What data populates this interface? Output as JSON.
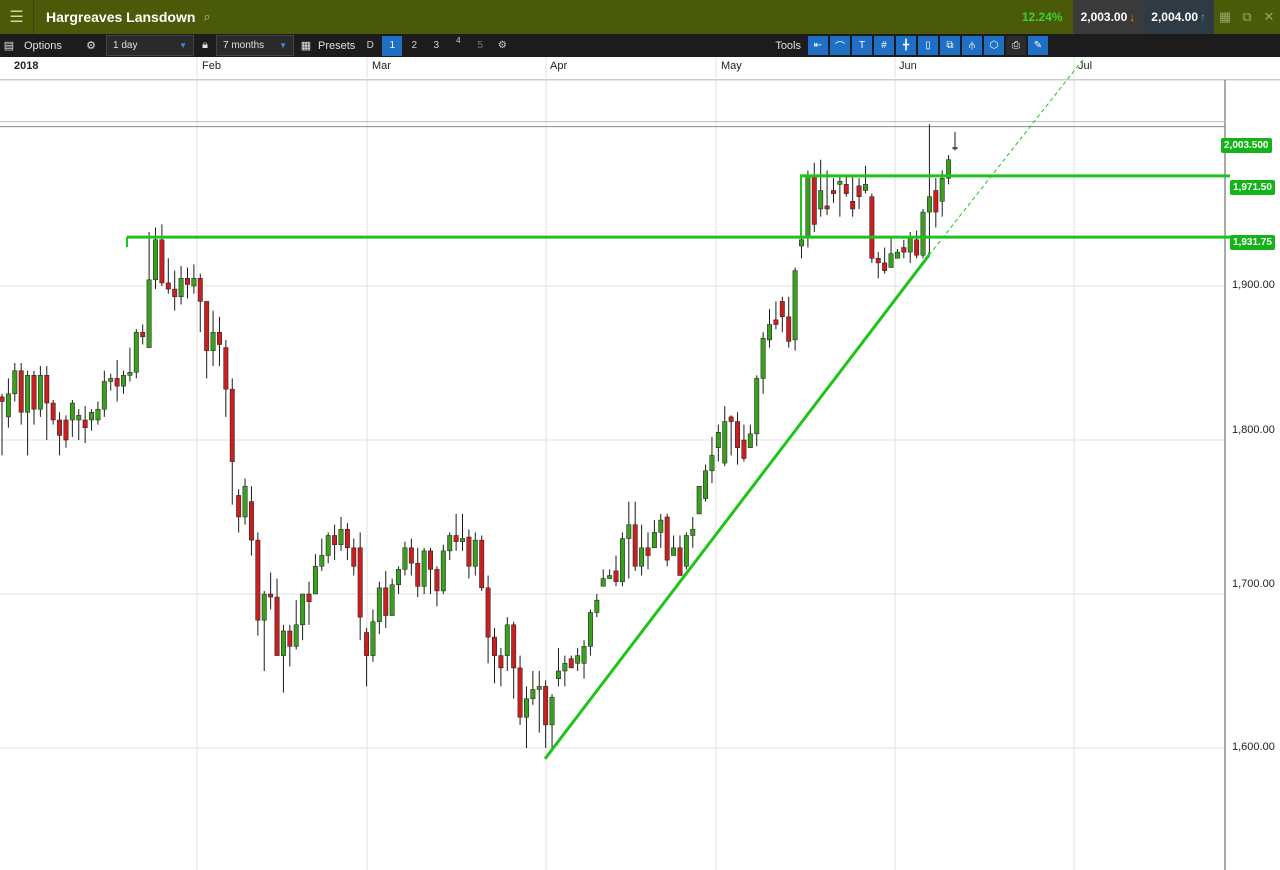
{
  "header": {
    "menu_icon": "hamburger-menu-icon",
    "title": "Hargreaves Lansdown",
    "search_icon": "search-icon",
    "change_pct": "12.24%",
    "sell_price": "2,003.00",
    "buy_price": "2,004.00",
    "colors": {
      "bar": "#4a5a08",
      "change": "#3bd12f"
    }
  },
  "toolbar": {
    "options_label": "Options",
    "interval_value": "1 day",
    "period_value": "7 months",
    "presets_label": "Presets",
    "presets": [
      "D",
      "1",
      "2",
      "3",
      "4",
      "5"
    ],
    "active_preset": "1",
    "tools_label": "Tools"
  },
  "chart_data": {
    "type": "candlestick",
    "x_ticks": [
      "2018",
      "Feb",
      "Mar",
      "Apr",
      "May",
      "Jun",
      "Jul"
    ],
    "y_ticks": [
      "1,600.00",
      "1,700.00",
      "1,800.00",
      "1,900.00"
    ],
    "ylim": [
      1500,
      2050
    ],
    "last_price_label": "2,003.500",
    "last_price": 2003.5,
    "levels": [
      {
        "label": "1,971.50",
        "value": 1971.5
      },
      {
        "label": "1,931.75",
        "value": 1931.75
      }
    ],
    "trendline": {
      "from": {
        "date": "2018-03-30",
        "price": 1593
      },
      "to": {
        "date": "2018-06-07",
        "price": 1920
      }
    },
    "ohlc": [
      [
        1828,
        1825,
        1830,
        1790
      ],
      [
        1815,
        1830,
        1840,
        1808
      ],
      [
        1830,
        1845,
        1850,
        1825
      ],
      [
        1845,
        1818,
        1850,
        1810
      ],
      [
        1818,
        1842,
        1845,
        1790
      ],
      [
        1842,
        1820,
        1845,
        1810
      ],
      [
        1820,
        1842,
        1848,
        1815
      ],
      [
        1842,
        1824,
        1848,
        1800
      ],
      [
        1824,
        1813,
        1826,
        1810
      ],
      [
        1813,
        1803,
        1818,
        1790
      ],
      [
        1813,
        1800,
        1816,
        1795
      ],
      [
        1813,
        1824,
        1826,
        1802
      ],
      [
        1813,
        1816,
        1820,
        1800
      ],
      [
        1813,
        1808,
        1822,
        1798
      ],
      [
        1813,
        1818,
        1820,
        1806
      ],
      [
        1813,
        1820,
        1825,
        1810
      ],
      [
        1820,
        1838,
        1845,
        1815
      ],
      [
        1838,
        1840,
        1843,
        1832
      ],
      [
        1840,
        1835,
        1852,
        1825
      ],
      [
        1835,
        1842,
        1845,
        1830
      ],
      [
        1842,
        1844,
        1860,
        1838
      ],
      [
        1844,
        1870,
        1872,
        1840
      ],
      [
        1870,
        1867,
        1875,
        1862
      ],
      [
        1860,
        1904,
        1935,
        1860
      ],
      [
        1904,
        1930,
        1938,
        1898
      ],
      [
        1930,
        1902,
        1940,
        1900
      ],
      [
        1902,
        1898,
        1918,
        1895
      ],
      [
        1898,
        1893,
        1910,
        1884
      ],
      [
        1893,
        1905,
        1913,
        1888
      ],
      [
        1905,
        1901,
        1912,
        1892
      ],
      [
        1900,
        1905,
        1914,
        1895
      ],
      [
        1905,
        1890,
        1908,
        1870
      ],
      [
        1890,
        1858,
        1890,
        1840
      ],
      [
        1858,
        1870,
        1884,
        1848
      ],
      [
        1870,
        1862,
        1880,
        1848
      ],
      [
        1860,
        1833,
        1865,
        1815
      ],
      [
        1833,
        1786,
        1840,
        1758
      ],
      [
        1764,
        1750,
        1768,
        1740
      ],
      [
        1750,
        1770,
        1775,
        1745
      ],
      [
        1760,
        1735,
        1770,
        1725
      ],
      [
        1735,
        1683,
        1740,
        1673
      ],
      [
        1683,
        1700,
        1702,
        1650
      ],
      [
        1700,
        1698,
        1714,
        1690
      ],
      [
        1698,
        1660,
        1710,
        1660
      ],
      [
        1660,
        1676,
        1680,
        1636
      ],
      [
        1676,
        1666,
        1680,
        1653
      ],
      [
        1666,
        1680,
        1696,
        1664
      ],
      [
        1680,
        1700,
        1700,
        1670
      ],
      [
        1700,
        1695,
        1708,
        1680
      ],
      [
        1700,
        1718,
        1726,
        1705
      ],
      [
        1718,
        1725,
        1736,
        1715
      ],
      [
        1725,
        1738,
        1740,
        1720
      ],
      [
        1738,
        1732,
        1745,
        1722
      ],
      [
        1732,
        1742,
        1750,
        1728
      ],
      [
        1742,
        1730,
        1746,
        1722
      ],
      [
        1730,
        1718,
        1736,
        1712
      ],
      [
        1730,
        1685,
        1740,
        1670
      ],
      [
        1675,
        1660,
        1678,
        1640
      ],
      [
        1660,
        1682,
        1690,
        1656
      ],
      [
        1682,
        1704,
        1708,
        1674
      ],
      [
        1704,
        1686,
        1715,
        1678
      ],
      [
        1686,
        1706,
        1710,
        1686
      ],
      [
        1706,
        1716,
        1718,
        1700
      ],
      [
        1716,
        1730,
        1734,
        1712
      ],
      [
        1730,
        1720,
        1736,
        1712
      ],
      [
        1720,
        1705,
        1730,
        1698
      ],
      [
        1705,
        1728,
        1730,
        1700
      ],
      [
        1728,
        1716,
        1730,
        1700
      ],
      [
        1716,
        1702,
        1718,
        1692
      ],
      [
        1702,
        1728,
        1732,
        1700
      ],
      [
        1728,
        1738,
        1740,
        1722
      ],
      [
        1738,
        1734,
        1752,
        1728
      ],
      [
        1734,
        1736,
        1752,
        1728
      ],
      [
        1737,
        1718,
        1742,
        1710
      ],
      [
        1718,
        1735,
        1740,
        1712
      ],
      [
        1735,
        1704,
        1738,
        1702
      ],
      [
        1704,
        1672,
        1712,
        1655
      ],
      [
        1672,
        1660,
        1678,
        1642
      ],
      [
        1660,
        1652,
        1665,
        1640
      ],
      [
        1660,
        1680,
        1685,
        1650
      ],
      [
        1680,
        1652,
        1682,
        1632
      ],
      [
        1652,
        1620,
        1660,
        1615
      ],
      [
        1620,
        1632,
        1640,
        1600
      ],
      [
        1632,
        1638,
        1650,
        1628
      ],
      [
        1638,
        1640,
        1650,
        1610
      ],
      [
        1640,
        1615,
        1644,
        1600
      ],
      [
        1615,
        1633,
        1635,
        1600
      ],
      [
        1645,
        1650,
        1665,
        1640
      ],
      [
        1650,
        1655,
        1660,
        1640
      ],
      [
        1658,
        1652,
        1660,
        1652
      ],
      [
        1655,
        1660,
        1665,
        1650
      ],
      [
        1655,
        1666,
        1670,
        1645
      ],
      [
        1666,
        1688,
        1690,
        1660
      ],
      [
        1688,
        1696,
        1700,
        1685
      ],
      [
        1705,
        1710,
        1716,
        1705
      ],
      [
        1710,
        1712,
        1716,
        1710
      ],
      [
        1715,
        1708,
        1725,
        1705
      ],
      [
        1708,
        1736,
        1740,
        1705
      ],
      [
        1736,
        1745,
        1760,
        1710
      ],
      [
        1745,
        1718,
        1760,
        1715
      ],
      [
        1718,
        1730,
        1745,
        1712
      ],
      [
        1730,
        1725,
        1740,
        1716
      ],
      [
        1730,
        1740,
        1748,
        1730
      ],
      [
        1740,
        1748,
        1752,
        1730
      ],
      [
        1750,
        1722,
        1752,
        1718
      ],
      [
        1725,
        1730,
        1738,
        1725
      ],
      [
        1730,
        1712,
        1738,
        1712
      ],
      [
        1718,
        1738,
        1740,
        1716
      ],
      [
        1738,
        1742,
        1750,
        1730
      ],
      [
        1752,
        1770,
        1768,
        1770
      ],
      [
        1762,
        1780,
        1784,
        1760
      ],
      [
        1780,
        1790,
        1802,
        1772
      ],
      [
        1795,
        1805,
        1810,
        1786
      ],
      [
        1785,
        1812,
        1822,
        1783
      ],
      [
        1815,
        1812,
        1816,
        1790
      ],
      [
        1812,
        1795,
        1818,
        1784
      ],
      [
        1800,
        1788,
        1810,
        1786
      ],
      [
        1795,
        1804,
        1810,
        1795
      ],
      [
        1804,
        1840,
        1842,
        1796
      ],
      [
        1840,
        1866,
        1870,
        1830
      ],
      [
        1865,
        1875,
        1885,
        1860
      ],
      [
        1878,
        1875,
        1890,
        1872
      ],
      [
        1890,
        1880,
        1893,
        1870
      ],
      [
        1880,
        1864,
        1893,
        1860
      ],
      [
        1865,
        1910,
        1912,
        1858
      ],
      [
        1926,
        1930,
        1942,
        1918
      ],
      [
        1932,
        1972,
        1975,
        1925
      ],
      [
        1972,
        1940,
        1980,
        1935
      ],
      [
        1950,
        1962,
        1982,
        1945
      ],
      [
        1952,
        1950,
        1975,
        1946
      ],
      [
        1962,
        1960,
        1970,
        1954
      ],
      [
        1966,
        1968,
        1972,
        1945
      ],
      [
        1966,
        1960,
        1972,
        1958
      ],
      [
        1955,
        1950,
        1972,
        1945
      ],
      [
        1965,
        1958,
        1970,
        1950
      ],
      [
        1962,
        1966,
        1978,
        1960
      ],
      [
        1958,
        1918,
        1960,
        1915
      ],
      [
        1918,
        1915,
        1922,
        1905
      ],
      [
        1915,
        1910,
        1925,
        1908
      ],
      [
        1912,
        1921,
        1932,
        1912
      ],
      [
        1918,
        1922,
        1924,
        1920
      ],
      [
        1925,
        1922,
        1930,
        1918
      ],
      [
        1922,
        1932,
        1935,
        1915
      ],
      [
        1930,
        1920,
        1936,
        1918
      ],
      [
        1920,
        1948,
        1950,
        1918
      ],
      [
        1948,
        1958,
        2005,
        1920
      ],
      [
        1962,
        1948,
        1970,
        1938
      ],
      [
        1955,
        1970,
        1975,
        1945
      ],
      [
        1970,
        1982,
        1985,
        1966
      ],
      [
        1990,
        1990,
        2000,
        1988
      ]
    ],
    "colors": {
      "up": "#3a9e1f",
      "down": "#c82020",
      "lines": "#1ec41a"
    }
  }
}
